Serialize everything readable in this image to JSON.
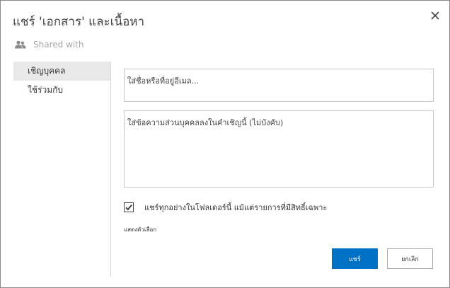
{
  "dialog": {
    "title": "แชร์ 'เอกสาร' และเนื้อหา",
    "close_icon": "close-icon"
  },
  "shared_with": {
    "label": "Shared with",
    "icon": "people-icon"
  },
  "sidebar": {
    "items": [
      {
        "label": "เชิญบุคคล",
        "active": true
      },
      {
        "label": "ใช้ร่วมกับ",
        "active": false
      }
    ]
  },
  "invite": {
    "placeholder": "ใส่ชื่อหรือที่อยู่อีเมล..."
  },
  "message": {
    "placeholder": "ใส่ข้อความส่วนบุคคลลงในคำเชิญนี้ (ไม่บังคับ)"
  },
  "share_all": {
    "label": "แชร์ทุกอย่างในโฟลเดอร์นี้ แม้แต่รายการที่มีสิทธิ์เฉพาะ",
    "checked": true
  },
  "options_link": "แสดงตัวเลือก",
  "buttons": {
    "share": "แชร์",
    "cancel": "ยกเลิก"
  },
  "colors": {
    "primary": "#0072c6",
    "nav_active_bg": "#e9e9e9"
  }
}
